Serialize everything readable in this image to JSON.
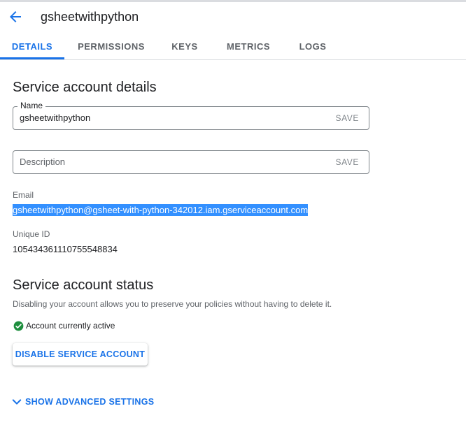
{
  "header": {
    "title": "gsheetwithpython",
    "back_icon": "arrow-left-icon"
  },
  "tabs": [
    {
      "label": "DETAILS",
      "active": true
    },
    {
      "label": "PERMISSIONS",
      "active": false
    },
    {
      "label": "KEYS",
      "active": false
    },
    {
      "label": "METRICS",
      "active": false
    },
    {
      "label": "LOGS",
      "active": false
    }
  ],
  "details": {
    "heading": "Service account details",
    "name_field": {
      "label": "Name",
      "value": "gsheetwithpython",
      "save_label": "SAVE"
    },
    "description_field": {
      "placeholder": "Description",
      "value": "",
      "save_label": "SAVE"
    },
    "email_label": "Email",
    "email_value": "gsheetwithpython@gsheet-with-python-342012.iam.gserviceaccount.com",
    "unique_id_label": "Unique ID",
    "unique_id_value": "105434361110755548834"
  },
  "status": {
    "heading": "Service account status",
    "description": "Disabling your account allows you to preserve your policies without having to delete it.",
    "status_text": "Account currently active",
    "status_icon": "check-circle-icon",
    "disable_button_label": "DISABLE SERVICE ACCOUNT"
  },
  "advanced": {
    "label": "SHOW ADVANCED SETTINGS",
    "icon": "chevron-down-icon"
  },
  "colors": {
    "accent": "#1a73e8",
    "success": "#1e8e3e",
    "selection": "#3390ff"
  }
}
